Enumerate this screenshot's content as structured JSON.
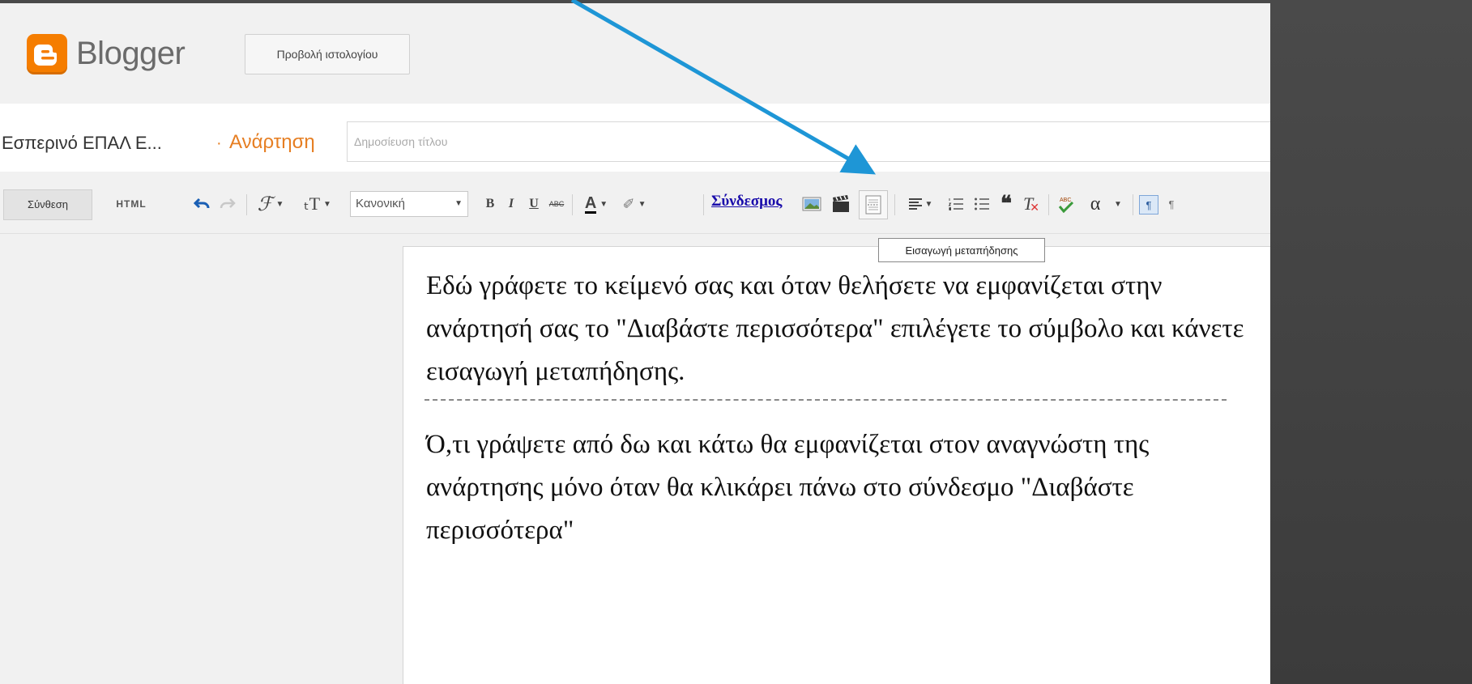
{
  "header": {
    "brand": "Blogger",
    "view_blog_label": "Προβολή ιστολογίου"
  },
  "title_row": {
    "blog_name": "Εσπερινό ΕΠΑΛ Ε...",
    "separator": "·",
    "post_label": "Ανάρτηση",
    "title_placeholder": "Δημοσίευση τίτλου"
  },
  "toolbar": {
    "compose_label": "Σύνθεση",
    "html_label": "HTML",
    "format_select": "Κανονική",
    "bold": "B",
    "italic": "I",
    "underline": "U",
    "strike": "ABC",
    "text_color": "A",
    "link_label": "Σύνδεσμος",
    "special_char": "α",
    "ltr": "¶",
    "rtl": "¶"
  },
  "tooltip": "Εισαγωγή μεταπήδησης",
  "editor": {
    "paragraph1": "Εδώ γράφετε το κείμενό σας και όταν θελήσετε να εμφανίζεται στην ανάρτησή σας το \"Διαβάστε περισσότερα\" επιλέγετε το σύμβολο και κάνετε εισαγωγή μεταπήδησης.",
    "paragraph2": "Ό,τι γράψετε από δω και κάτω θα εμφανίζεται  στον αναγνώστη της ανάρτησης μόνο όταν θα κλικάρει πάνω στο σύνδεσμο \"Διαβάστε περισσότερα\""
  },
  "colors": {
    "accent": "#e67e22",
    "logo": "#f57d00",
    "arrow": "#1e96d6",
    "link": "#1a0dab"
  }
}
